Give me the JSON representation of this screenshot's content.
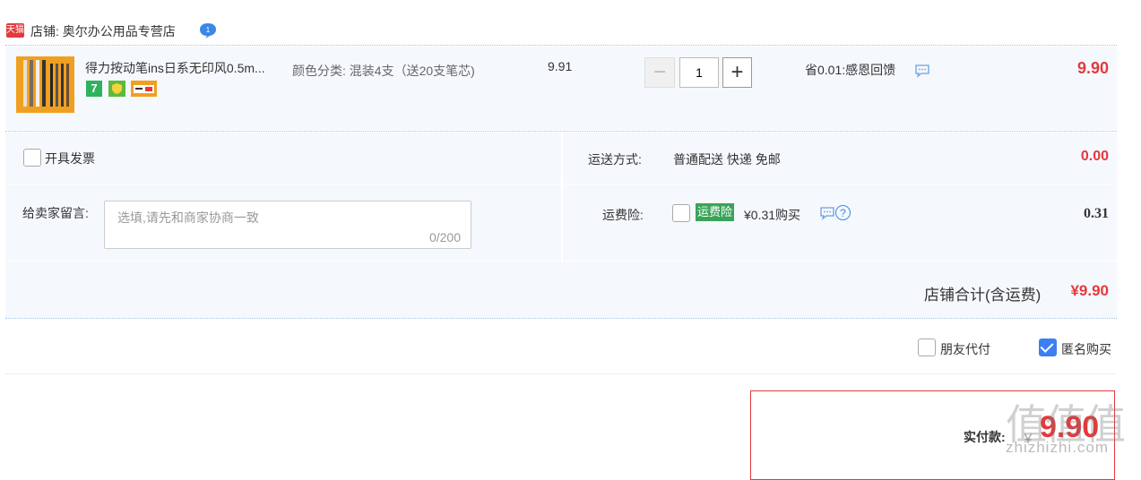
{
  "shop": {
    "badge": "天猫",
    "name": "店铺: 奥尔办公用品专营店",
    "chat_count": "1"
  },
  "item": {
    "title": "得力按动笔ins日系无印风0.5m...",
    "tag_7": "7",
    "spec": "颜色分类: 混装4支（送20支笔芯)",
    "unit_price": "9.91",
    "quantity": "1",
    "minus": "−",
    "plus": "+",
    "promotion": "省0.01:感恩回馈",
    "total": "9.90"
  },
  "options": {
    "invoice_label": "开具发票",
    "shipping_label": "运送方式:",
    "shipping_value": "普通配送 快递 免邮",
    "shipping_fee": "0.00",
    "message_label": "给卖家留言:",
    "message_placeholder": "选填,请先和商家协商一致",
    "message_count": "0/200",
    "insurance_label": "运费险:",
    "insurance_badge": "运费险",
    "insurance_price": "¥0.31购买",
    "insurance_help": "?",
    "insurance_fee": "0.31",
    "shop_total_label": "店铺合计(含运费)",
    "shop_total_value": "¥9.90"
  },
  "payment_options": {
    "friend_pay_label": "朋友代付",
    "friend_pay_checked": false,
    "anonymous_label": "匿名购买",
    "anonymous_checked": true
  },
  "pay": {
    "label": "实付款:",
    "currency": "￥",
    "amount": "9.90"
  },
  "watermark": {
    "logo": "值值值",
    "url": "zhizhizhi.com"
  },
  "colors": {
    "price_red": "#e4393c",
    "row_bg": "#f5f8fd",
    "checkbox_blue": "#3d7ff0",
    "insurance_green": "#3aa35a"
  }
}
